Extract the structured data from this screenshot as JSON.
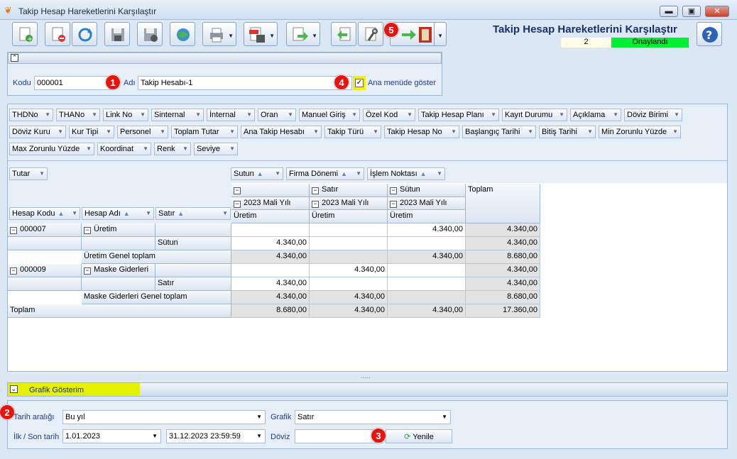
{
  "window": {
    "title": "Takip Hesap Hareketlerini Karşılaştır",
    "min": "▬",
    "max": "▣",
    "close": "✕"
  },
  "header": {
    "title": "Takip Hesap Hareketlerini Karşılaştır",
    "count": "2",
    "status": "Onaylandı",
    "status_color": "#00ee33"
  },
  "toolbar": {
    "icons": [
      "new-document-icon",
      "delete-document-icon",
      "refresh-icon",
      "save-icon",
      "cancel-save-icon",
      "globe-check-icon",
      "print-icon",
      "pdf-export-icon",
      "transfer-icon",
      "import-icon",
      "tools-icon",
      "exit-icon",
      "help-icon"
    ]
  },
  "badges": {
    "b1": "1",
    "b2": "2",
    "b3": "3",
    "b4": "4",
    "b5": "5"
  },
  "form": {
    "kodu_label": "Kodu",
    "kodu": "000001",
    "adi_label": "Adı",
    "adi": "Takip Hesabı-1",
    "ana_menu_label": "Ana menüde göster",
    "ana_menu_checked": true
  },
  "filter_fields": {
    "row1": [
      "THDNo",
      "THANo",
      "Link No",
      "Sinternal",
      "İnternal",
      "Oran",
      "Manuel Giriş",
      "Özel Kod",
      "Takip Hesap Planı",
      "Kayıt Durumu",
      "Açıklama",
      "Döviz Birimi"
    ],
    "row2": [
      "Döviz Kuru",
      "Kur Tipi",
      "Personel",
      "Toplam Tutar",
      "Ana Takip Hesabı",
      "Takip Türü",
      "Takip Hesap No",
      "Başlangıç Tarihi",
      "Bitiş Tarihi",
      "Min Zorunlu Yüzde"
    ],
    "row3": [
      "Max Zorunlu Yüzde",
      "Koordinat",
      "Renk",
      "Seviye"
    ]
  },
  "pivot": {
    "data_field": "Tutar",
    "column_fields": [
      "Sutun",
      "Firma Dönemi",
      "İşlem Noktası"
    ],
    "row_fields": [
      "Hesap Kodu",
      "Hesap Adı",
      "Satır"
    ],
    "col_headers": {
      "l1": [
        "Satır",
        "Sütun"
      ],
      "toplam": "Toplam",
      "year": "2023 Mali Yılı",
      "uretim": "Üretim"
    },
    "rows": [
      {
        "c0": "000007",
        "c1": "Üretim",
        "c2": "",
        "v": [
          "",
          "",
          "4.340,00",
          "4.340,00"
        ]
      },
      {
        "c0": "",
        "c1": "",
        "c2": "Sütun",
        "v": [
          "4.340,00",
          "",
          "",
          "4.340,00"
        ]
      },
      {
        "c0": "",
        "c1": "Üretim Genel toplam",
        "c2": "",
        "v": [
          "4.340,00",
          "",
          "4.340,00",
          "8.680,00"
        ]
      },
      {
        "c0": "000009",
        "c1": "Maske Giderleri",
        "c2": "",
        "v": [
          "",
          "4.340,00",
          "",
          "4.340,00"
        ]
      },
      {
        "c0": "",
        "c1": "",
        "c2": "Satır",
        "v": [
          "4.340,00",
          "",
          "",
          "4.340,00"
        ]
      },
      {
        "c0": "",
        "c1": "Maske Giderleri Genel toplam",
        "c2": "",
        "v": [
          "4.340,00",
          "4.340,00",
          "",
          "8.680,00"
        ]
      },
      {
        "c0": "Toplam",
        "c1": "",
        "c2": "",
        "v": [
          "8.680,00",
          "4.340,00",
          "4.340,00",
          "17.360,00"
        ]
      }
    ]
  },
  "grafik": {
    "title": "Grafik Gösterim",
    "tarih_label": "Tarih aralığı",
    "tarih": "Bu yıl",
    "grafik_label": "Grafik",
    "grafik": "Satır",
    "ilk_son_label": "İlk / Son tarih",
    "ilk": "1.01.2023",
    "son": "31.12.2023 23:59:59",
    "doviz_label": "Döviz",
    "doviz": "",
    "yenile": "Yenile"
  },
  "splitter": "....."
}
